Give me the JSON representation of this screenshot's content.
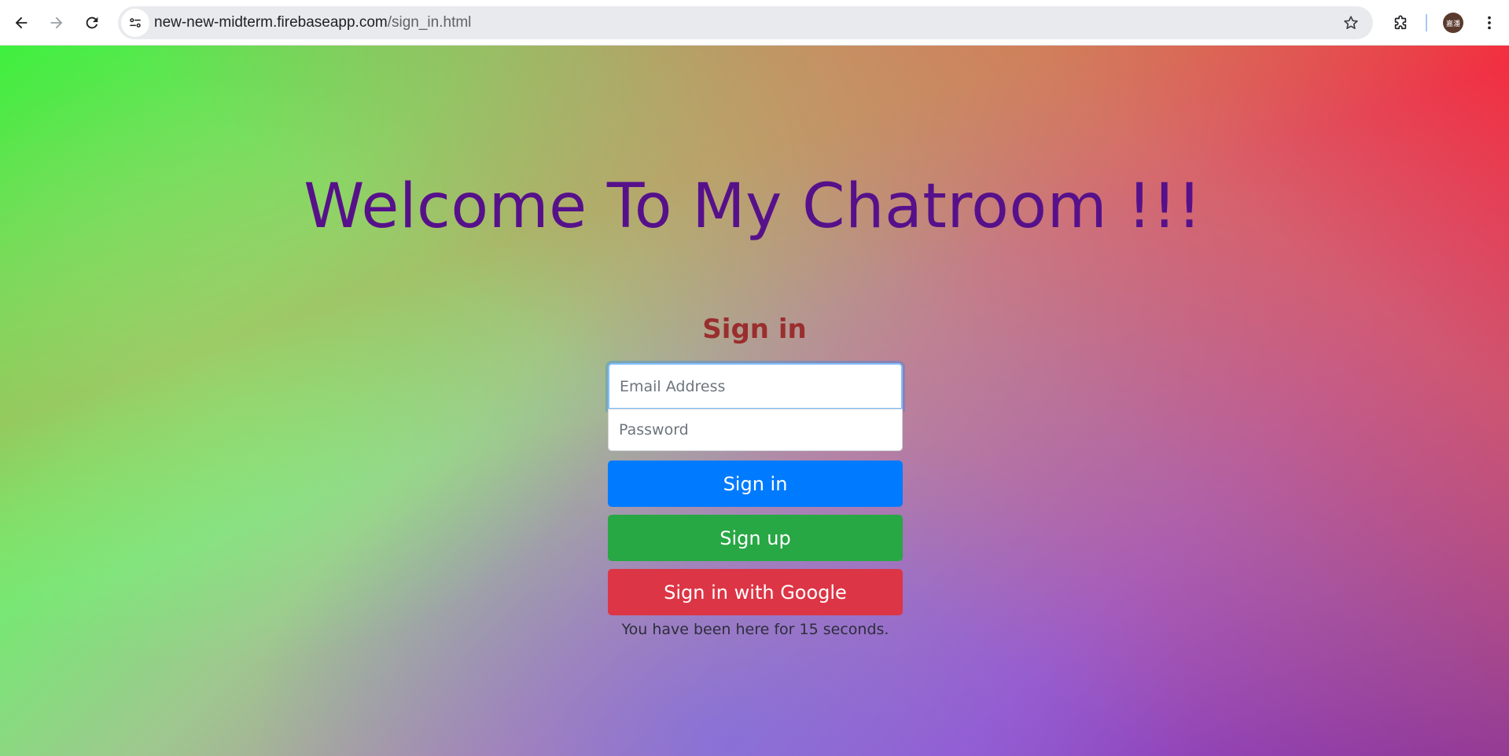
{
  "browser": {
    "url_host": "new-new-midterm.firebaseapp.com",
    "url_path": "/sign_in.html",
    "profile_initials": "嘉潘"
  },
  "page": {
    "heading": "Welcome To My Chatroom !!!",
    "form_title": "Sign in",
    "email_placeholder": "Email Address",
    "password_placeholder": "Password",
    "sign_in_label": "Sign in",
    "sign_up_label": "Sign up",
    "google_label": "Sign in with Google",
    "timer_text": "You have been here for 15 seconds."
  },
  "colors": {
    "heading": "#56118a",
    "form_title": "#9a2e2e",
    "primary": "#007bff",
    "success": "#28a745",
    "danger": "#dc3545"
  }
}
